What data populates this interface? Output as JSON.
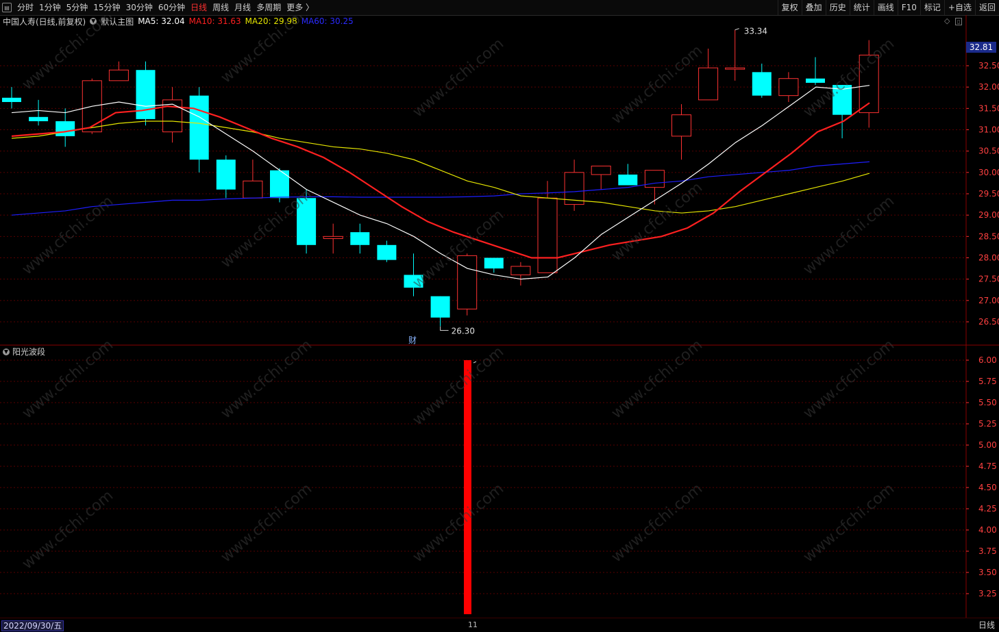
{
  "toolbar": {
    "periods": [
      "分时",
      "1分钟",
      "5分钟",
      "15分钟",
      "30分钟",
      "60分钟",
      "日线",
      "周线",
      "月线",
      "多周期",
      "更多 〉"
    ],
    "active_period": "日线",
    "right_buttons": [
      "复权",
      "叠加",
      "历史",
      "统计",
      "画线",
      "F10",
      "标记",
      "+自选",
      "返回"
    ]
  },
  "info": {
    "stock": "中国人寿(日线,前复权)",
    "chart_name": "默认主图",
    "ma5": "MA5: 32.04",
    "ma10": "MA10: 31.63",
    "ma20": "MA20: 29.98",
    "ma60": "MA60: 30.25"
  },
  "colors": {
    "up": "#ff3232",
    "down": "#00ffff",
    "ma5": "#ffffff",
    "ma10": "#ff2020",
    "ma20": "#e6e600",
    "ma60": "#1e1eff",
    "grid": "#5a0000"
  },
  "main_axis": [
    "32.50",
    "32.00",
    "31.50",
    "31.00",
    "30.50",
    "30.00",
    "29.50",
    "29.00",
    "28.50",
    "28.00",
    "27.50",
    "27.00",
    "26.50"
  ],
  "current_price": "32.81",
  "high_label": "33.34",
  "low_label": "26.30",
  "finance_marker": "财",
  "indicator": {
    "title": "阳光波段",
    "axis": [
      "6.00",
      "5.75",
      "5.50",
      "5.25",
      "5.00",
      "4.75",
      "4.50",
      "4.25",
      "4.00",
      "3.75",
      "3.50",
      "3.25"
    ],
    "bar_value": 6.0
  },
  "bottom": {
    "date": "2022/09/30/五",
    "month_marker": "11",
    "period": "日线"
  },
  "watermark": "www.cfchi.com",
  "chart_data": {
    "type": "candlestick",
    "ylim": [
      26.1,
      33.6
    ],
    "candles": [
      {
        "o": 31.75,
        "h": 32.0,
        "l": 31.5,
        "c": 31.65
      },
      {
        "o": 31.3,
        "h": 31.7,
        "l": 31.1,
        "c": 31.2
      },
      {
        "o": 31.2,
        "h": 31.5,
        "l": 30.6,
        "c": 30.85
      },
      {
        "o": 30.95,
        "h": 32.2,
        "l": 30.9,
        "c": 32.15
      },
      {
        "o": 32.15,
        "h": 32.6,
        "l": 32.15,
        "c": 32.4
      },
      {
        "o": 32.4,
        "h": 32.6,
        "l": 31.1,
        "c": 31.25
      },
      {
        "o": 30.95,
        "h": 32.0,
        "l": 30.7,
        "c": 31.7
      },
      {
        "o": 31.8,
        "h": 32.0,
        "l": 30.0,
        "c": 30.3
      },
      {
        "o": 30.3,
        "h": 30.4,
        "l": 29.4,
        "c": 29.6
      },
      {
        "o": 29.4,
        "h": 30.3,
        "l": 29.4,
        "c": 29.8
      },
      {
        "o": 30.05,
        "h": 30.1,
        "l": 29.3,
        "c": 29.4
      },
      {
        "o": 29.4,
        "h": 29.6,
        "l": 28.1,
        "c": 28.3
      },
      {
        "o": 28.45,
        "h": 28.8,
        "l": 28.1,
        "c": 28.5
      },
      {
        "o": 28.6,
        "h": 28.8,
        "l": 28.1,
        "c": 28.3
      },
      {
        "o": 28.3,
        "h": 28.4,
        "l": 27.9,
        "c": 27.95
      },
      {
        "o": 27.6,
        "h": 28.1,
        "l": 27.1,
        "c": 27.3
      },
      {
        "o": 27.1,
        "h": 27.1,
        "l": 26.4,
        "c": 26.6
      },
      {
        "o": 26.8,
        "h": 28.1,
        "l": 26.65,
        "c": 28.05
      },
      {
        "o": 28.0,
        "h": 28.0,
        "l": 27.65,
        "c": 27.75
      },
      {
        "o": 27.6,
        "h": 27.9,
        "l": 27.35,
        "c": 27.8
      },
      {
        "o": 27.65,
        "h": 29.8,
        "l": 27.65,
        "c": 29.4
      },
      {
        "o": 29.25,
        "h": 30.3,
        "l": 29.1,
        "c": 30.0
      },
      {
        "o": 29.95,
        "h": 30.15,
        "l": 29.6,
        "c": 30.15
      },
      {
        "o": 29.95,
        "h": 30.2,
        "l": 29.7,
        "c": 29.7
      },
      {
        "o": 29.65,
        "h": 30.05,
        "l": 29.25,
        "c": 30.05
      },
      {
        "o": 30.85,
        "h": 31.6,
        "l": 30.3,
        "c": 31.35
      },
      {
        "o": 31.7,
        "h": 32.9,
        "l": 31.7,
        "c": 32.45
      },
      {
        "o": 32.45,
        "h": 33.34,
        "l": 32.15,
        "c": 32.45
      },
      {
        "o": 32.35,
        "h": 32.55,
        "l": 31.75,
        "c": 31.8
      },
      {
        "o": 31.8,
        "h": 32.35,
        "l": 31.65,
        "c": 32.2
      },
      {
        "o": 32.2,
        "h": 32.7,
        "l": 32.05,
        "c": 32.1
      },
      {
        "o": 32.05,
        "h": 32.05,
        "l": 30.8,
        "c": 31.35
      },
      {
        "o": 31.4,
        "h": 33.1,
        "l": 31.05,
        "c": 32.75
      }
    ],
    "ma5": [
      31.4,
      31.45,
      31.4,
      31.55,
      31.65,
      31.55,
      31.6,
      31.3,
      30.9,
      30.5,
      30.05,
      29.6,
      29.3,
      29.0,
      28.8,
      28.5,
      28.1,
      27.75,
      27.6,
      27.5,
      27.55,
      28.0,
      28.55,
      28.95,
      29.35,
      29.75,
      30.2,
      30.7,
      31.1,
      31.55,
      32.0,
      31.95,
      32.04
    ],
    "ma10": [
      30.85,
      30.9,
      30.95,
      31.05,
      31.4,
      31.45,
      31.55,
      31.5,
      31.3,
      31.05,
      30.8,
      30.6,
      30.35,
      30.0,
      29.6,
      29.2,
      28.85,
      28.6,
      28.4,
      28.2,
      28.0,
      28.0,
      28.15,
      28.3,
      28.4,
      28.5,
      28.7,
      29.05,
      29.55,
      30.0,
      30.45,
      30.95,
      31.2,
      31.63
    ],
    "ma20": [
      30.8,
      30.85,
      30.95,
      31.05,
      31.15,
      31.2,
      31.2,
      31.15,
      31.05,
      30.95,
      30.8,
      30.7,
      30.6,
      30.55,
      30.45,
      30.3,
      30.05,
      29.8,
      29.65,
      29.45,
      29.4,
      29.35,
      29.3,
      29.2,
      29.1,
      29.05,
      29.1,
      29.2,
      29.35,
      29.5,
      29.65,
      29.8,
      29.98
    ],
    "ma60": [
      29.0,
      29.05,
      29.1,
      29.2,
      29.25,
      29.3,
      29.35,
      29.35,
      29.38,
      29.4,
      29.42,
      29.43,
      29.43,
      29.42,
      29.42,
      29.42,
      29.42,
      29.43,
      29.45,
      29.5,
      29.52,
      29.55,
      29.6,
      29.65,
      29.75,
      29.8,
      29.9,
      29.95,
      30.0,
      30.05,
      30.15,
      30.2,
      30.25
    ]
  }
}
